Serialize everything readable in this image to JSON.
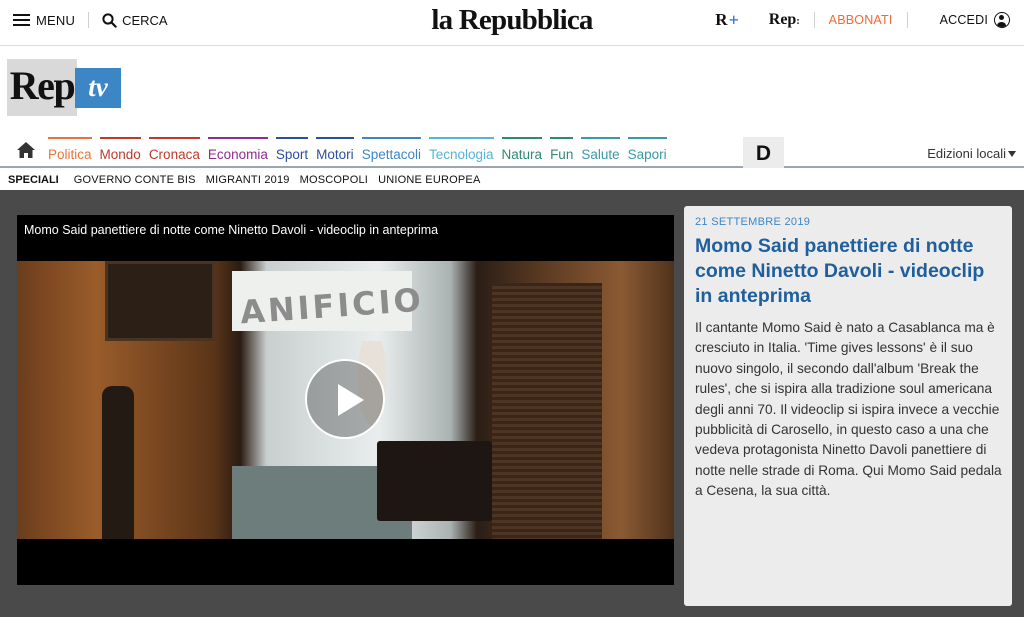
{
  "header": {
    "menu_label": "MENU",
    "search_label": "CERCA",
    "logo_text": "la Repubblica",
    "rplus_letter": "R",
    "rplus_symbol": "+",
    "reps_text": "Rep",
    "reps_suffix": ":",
    "abbonati_label": "ABBONATI",
    "accedi_label": "ACCEDI",
    "accent_color": "#f06a35"
  },
  "brand": {
    "rep": "Rep",
    "tv": "tv",
    "tv_color": "#3d86c6"
  },
  "nav": {
    "items": [
      {
        "label": "Politica",
        "color": "#e8743b"
      },
      {
        "label": "Mondo",
        "color": "#c0392b"
      },
      {
        "label": "Cronaca",
        "color": "#c0392b"
      },
      {
        "label": "Economia",
        "color": "#8e2d8e"
      },
      {
        "label": "Sport",
        "color": "#2c4f9e"
      },
      {
        "label": "Motori",
        "color": "#2c4f9e"
      },
      {
        "label": "Spettacoli",
        "color": "#3d86c6"
      },
      {
        "label": "Tecnologia",
        "color": "#57b2dc"
      },
      {
        "label": "Natura",
        "color": "#2f8a72"
      },
      {
        "label": "Fun",
        "color": "#2f8a72"
      },
      {
        "label": "Salute",
        "color": "#3a9aa6"
      },
      {
        "label": "Sapori",
        "color": "#3a9aa6"
      }
    ],
    "d_label": "D",
    "edizioni_label": "Edizioni locali"
  },
  "speciali": {
    "label": "SPECIALI",
    "items": [
      "GOVERNO CONTE BIS",
      "MIGRANTI 2019",
      "MOSCOPOLI",
      "UNIONE EUROPEA"
    ]
  },
  "video": {
    "player_title": "Momo Said panettiere di notte come Ninetto Davoli - videoclip in anteprima",
    "sign_text": "ANIFICIO"
  },
  "article": {
    "date": "21 SETTEMBRE 2019",
    "title": "Momo Said panettiere di notte come Ninetto Davoli - videoclip in anteprima",
    "description": "Il cantante Momo Said è nato a Casablanca ma è cresciuto in Italia. 'Time gives lessons' è il suo nuovo singolo, il secondo dall'album 'Break the rules', che si ispira alla tradizione soul americana degli anni 70. Il videoclip si ispira invece a vecchie pubblicità di Carosello, in questo caso a una che vedeva protagonista Ninetto Davoli panettiere di notte nelle strade di Roma. Qui Momo Said pedala a Cesena, la sua città."
  }
}
